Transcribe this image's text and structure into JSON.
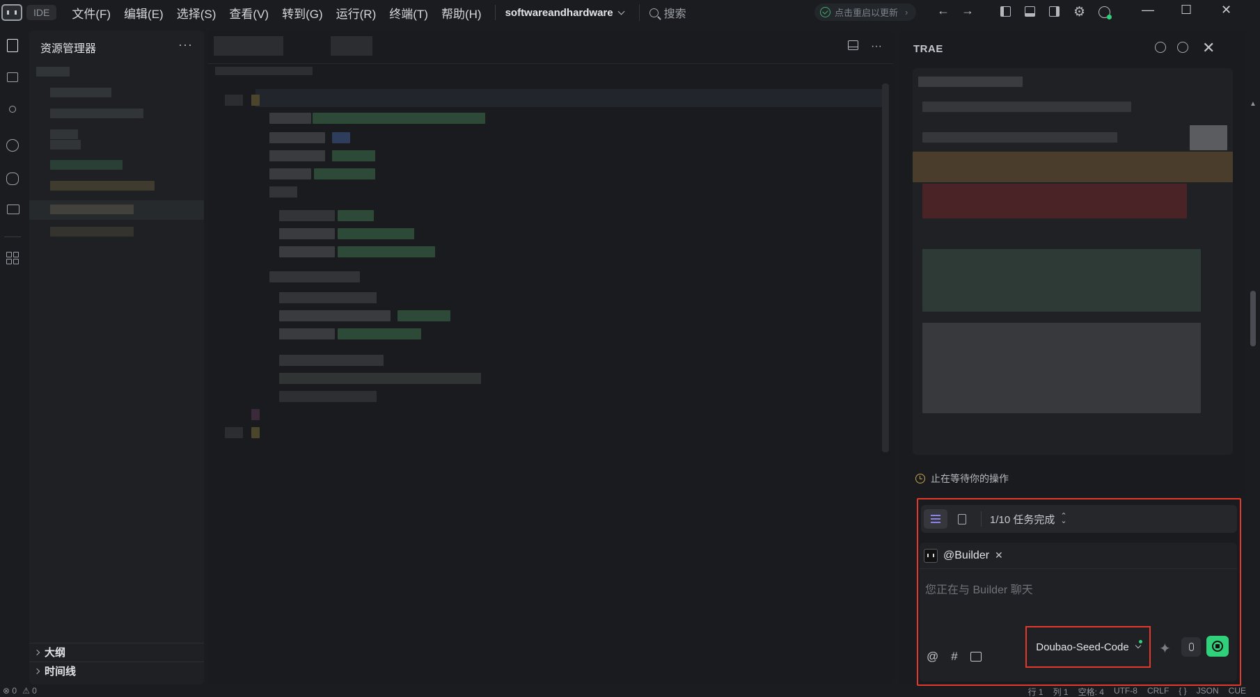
{
  "titlebar": {
    "ide_label": "IDE",
    "menu": [
      "文件(F)",
      "编辑(E)",
      "选择(S)",
      "查看(V)",
      "转到(G)",
      "运行(R)",
      "终端(T)",
      "帮助(H)"
    ],
    "workspace": "softwareandhardware",
    "search_label": "搜索",
    "update_label": "点击重启以更新",
    "window_buttons": [
      "—",
      "☐",
      "✕"
    ]
  },
  "activity_icons": [
    "explorer-icon",
    "search-icon",
    "source-control-icon",
    "preview-icon",
    "debug-icon",
    "remote-icon",
    "extensions-icon"
  ],
  "sidebar": {
    "title": "资源管理器",
    "more": "···",
    "sections": [
      "大纲",
      "时间线"
    ]
  },
  "panel": {
    "title": "TRAE",
    "waiting_text": "止在等待你的操作",
    "task_progress": "1/10 任务完成",
    "agent": "@Builder",
    "placeholder": "您正在与 Builder 聊天",
    "at_symbol": "@",
    "hash_symbol": "#",
    "model": "Doubao-Seed-Code"
  },
  "statusbar": {
    "left": [
      "⊗ 0",
      "⚠ 0"
    ],
    "right": [
      "行 1",
      "列 1",
      "空格: 4",
      "UTF-8",
      "CRLF",
      "{ }",
      "JSON",
      "CUE"
    ]
  },
  "colors": {
    "accent_green": "#2fd27a",
    "highlight_red": "#e2392d",
    "task_icon_purple": "#8b83e6"
  }
}
